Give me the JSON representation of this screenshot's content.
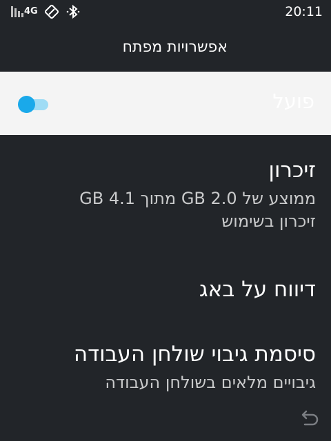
{
  "status_bar": {
    "network_type": "4G",
    "time": "20:11",
    "icons": [
      "signal-bars-icon",
      "screen-rotation-icon",
      "bluetooth-icon"
    ]
  },
  "header": {
    "title": "אפשרויות מפתח"
  },
  "master_switch": {
    "label": "פועל",
    "enabled": true,
    "accent": "#1aa9ea"
  },
  "preferences": [
    {
      "title": "זיכרון",
      "summary_line1": "ממוצע של 2.0 GB מתוך 4.1 GB",
      "summary_line2": "זיכרון בשימוש"
    },
    {
      "title": "דיווח על באג"
    },
    {
      "title": "סיסמת גיבוי שולחן העבודה",
      "summary": "גיבויים מלאים בשולחן העבודה"
    }
  ],
  "nav": {
    "icon": "back-icon"
  },
  "colors": {
    "background": "#222529",
    "master_row_background": "#f4f4f4",
    "switch_thumb": "#1aa9ea",
    "switch_track": "#9fdcf5"
  }
}
